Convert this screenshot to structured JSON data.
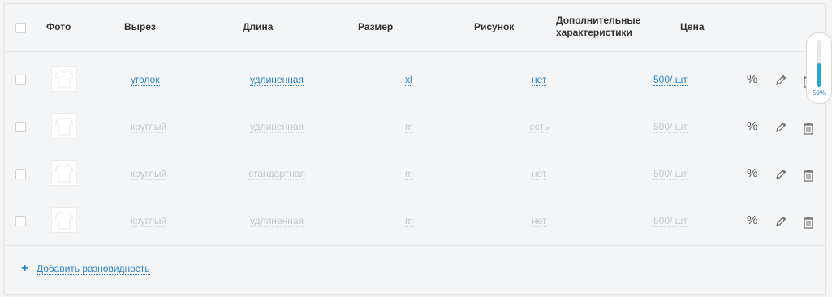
{
  "header": {
    "photo": "Фото",
    "neckline": "Вырез",
    "length": "Длина",
    "size": "Размер",
    "pattern": "Рисунок",
    "extra_line1": "Дополнительные",
    "extra_line2": "характеристики",
    "price": "Цена"
  },
  "rows": [
    {
      "neckline": "уголок",
      "length": "удлиненная",
      "size": "xl",
      "pattern": "нет",
      "price": "500/ шт",
      "active": true
    },
    {
      "neckline": "круглый",
      "length": "удлиненная",
      "size": "m",
      "pattern": "есть",
      "price": "500/ шт",
      "active": false
    },
    {
      "neckline": "круглый",
      "length": "стандартная",
      "size": "m",
      "pattern": "нет",
      "price": "500/ шт",
      "active": false
    },
    {
      "neckline": "круглый",
      "length": "удлиненная",
      "size": "m",
      "pattern": "нет",
      "price": "500/ шт",
      "active": false
    }
  ],
  "actions": {
    "percent_glyph": "%"
  },
  "footer": {
    "plus": "+",
    "add_label": "Добавить разновидность"
  },
  "zoom": {
    "label": "50%",
    "level": 0.5
  },
  "colors": {
    "accent": "#2b83c6",
    "muted": "#c4c7ca"
  }
}
